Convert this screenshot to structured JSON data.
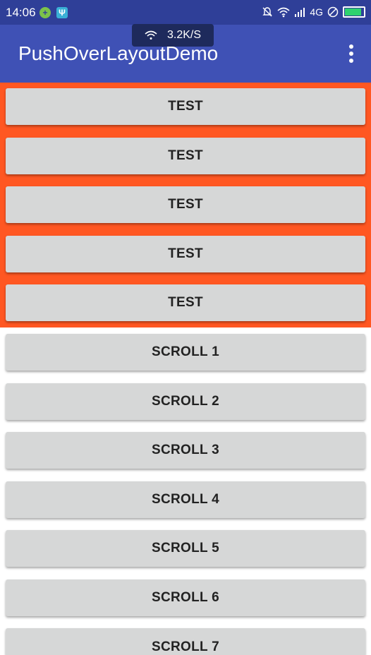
{
  "status_bar": {
    "time": "14:06",
    "network_type": "4G",
    "icons": [
      "notification-plus-icon",
      "usb-icon",
      "mute-bell-icon",
      "wifi-icon",
      "signal-icon",
      "no-sim-icon",
      "battery-icon"
    ],
    "battery_level": 0.9
  },
  "net_speed": {
    "value": "3.2K/S"
  },
  "app_bar": {
    "title": "PushOverLayoutDemo"
  },
  "colors": {
    "app_bar": "#3f51b5",
    "status_bar": "#2f3f98",
    "header_bg": "#ff5722",
    "button_bg": "#d6d7d7"
  },
  "header_buttons": [
    "TEST",
    "TEST",
    "TEST",
    "TEST",
    "TEST"
  ],
  "scroll_buttons": [
    "SCROLL 1",
    "SCROLL 2",
    "SCROLL 3",
    "SCROLL 4",
    "SCROLL 5",
    "SCROLL 6",
    "SCROLL 7"
  ]
}
